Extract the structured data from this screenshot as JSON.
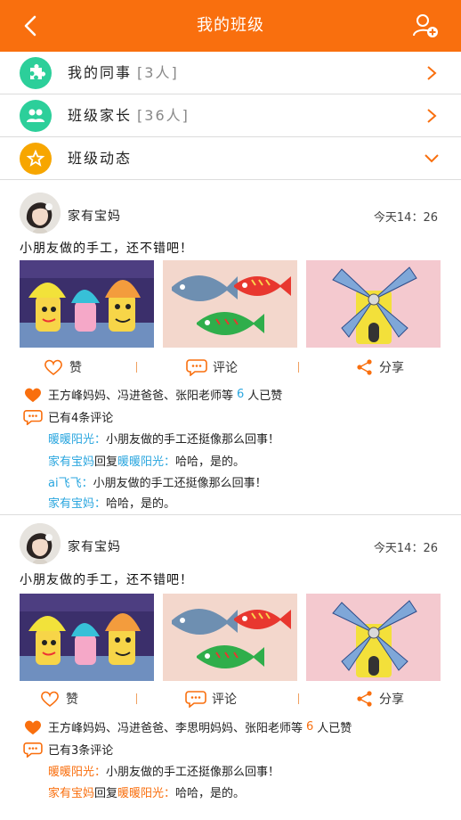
{
  "header": {
    "title": "我的班级",
    "back_icon": "chevron-left-icon",
    "add_user_icon": "add-user-icon",
    "bg_color": "#f96f0e"
  },
  "menu": [
    {
      "label": "我的同事",
      "count": "[3人]",
      "icon": "puzzle-icon",
      "color": "#2ccf9a",
      "arrow": "chevron-right-icon"
    },
    {
      "label": "班级家长",
      "count": "[36人]",
      "icon": "people-icon",
      "color": "#2ccf9a",
      "arrow": "chevron-right-icon"
    },
    {
      "label": "班级动态",
      "count": "",
      "icon": "star-icon",
      "color": "#f7a600",
      "arrow": "chevron-down-icon"
    }
  ],
  "posts": [
    {
      "user": "家有宝妈",
      "time": "今天14：26",
      "text": "小朋友做的手工，还不错吧！",
      "actions": {
        "like": "赞",
        "comment": "评论",
        "share": "分享"
      },
      "likes": {
        "names": "王方峰妈妈、冯进爸爸、张阳老师等",
        "count": "6",
        "suffix": "人已赞"
      },
      "comment_summary": "已有4条评论",
      "comments": [
        {
          "from": "暖暖阳光：",
          "reply_word": "",
          "to": "",
          "text": "小朋友做的手工还挺像那么回事！"
        },
        {
          "from": "家有宝妈",
          "reply_word": "回复",
          "to": "暖暖阳光：",
          "text": "哈哈，是的。"
        },
        {
          "from": "ai飞飞：",
          "reply_word": "",
          "to": "",
          "text": "小朋友做的手工还挺像那么回事！"
        },
        {
          "from": "家有宝妈：",
          "reply_word": "",
          "to": "",
          "text": "哈哈，是的。"
        }
      ],
      "accent": "#2aa6df"
    },
    {
      "user": "家有宝妈",
      "time": "今天14：26",
      "text": "小朋友做的手工，还不错吧！",
      "actions": {
        "like": "赞",
        "comment": "评论",
        "share": "分享"
      },
      "likes": {
        "names": "王方峰妈妈、冯进爸爸、李思明妈妈、张阳老师等",
        "count": "6",
        "suffix": "人已赞"
      },
      "comment_summary": "已有3条评论",
      "comments": [
        {
          "from": "暖暖阳光：",
          "reply_word": "",
          "to": "",
          "text": "小朋友做的手工还挺像那么回事！"
        },
        {
          "from": "家有宝妈",
          "reply_word": "回复",
          "to": "暖暖阳光：",
          "text": "哈哈，是的。"
        }
      ],
      "accent": "#f96f0e"
    }
  ]
}
